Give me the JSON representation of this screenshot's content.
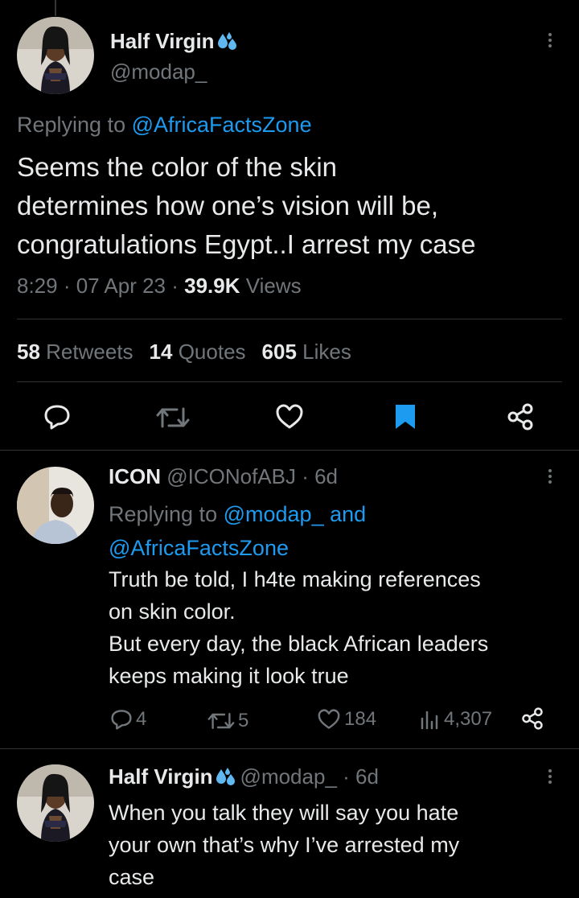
{
  "main_tweet": {
    "display_name": "Half Virgin",
    "handle": "@modap_",
    "replying_prefix": "Replying to",
    "replying_to": "@AfricaFactsZone",
    "text_lines": [
      "Seems the color of the skin",
      "determines how one’s vision will be,",
      "congratulations Egypt..I arrest my case"
    ],
    "time": "8:29 · 07 Apr 23 ·",
    "views_count": "39.9K",
    "views_label": "Views",
    "retweets_count": "58",
    "retweets_label": "Retweets",
    "quotes_count": "14",
    "quotes_label": "Quotes",
    "likes_count": "605",
    "likes_label": "Likes",
    "actions": [
      "reply-icon",
      "retweet-icon",
      "like-icon",
      "bookmark-icon",
      "share-icon"
    ]
  },
  "reply_1": {
    "display_name": "ICON",
    "handle_time": "@ICONofABJ · 6d",
    "replying_prefix": "Replying to",
    "replying_to_1": "@modap_",
    "replying_and": "and",
    "replying_to_2": "@AfricaFactsZone",
    "text_lines": [
      "Truth be told, I h4te making references",
      "on skin color.",
      "But every day, the black African leaders",
      "keeps making it look true"
    ],
    "replies": "4",
    "retweets": "5",
    "likes": "184",
    "views": "4,307"
  },
  "reply_2": {
    "display_name": "Half Virgin",
    "handle_time": "@modap_ · 6d",
    "text_lines": [
      "When you talk they will say you hate",
      "your own that’s why I’ve arrested my",
      "case"
    ]
  },
  "colors": {
    "background": "#000000",
    "text": "#e7e9ea",
    "secondary": "#71767b",
    "link": "#1d9bf0",
    "divider": "#2f3336"
  }
}
